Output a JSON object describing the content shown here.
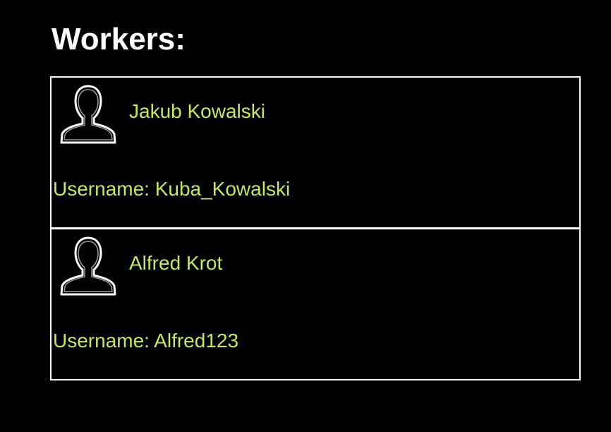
{
  "page": {
    "title": "Workers:"
  },
  "colors": {
    "background": "#000000",
    "title": "#ffffff",
    "accent_text": "#c5e860",
    "border": "#ffffff"
  },
  "workers": [
    {
      "name": "Jakub Kowalski",
      "username_line": "Username: Kuba_Kowalski",
      "icon": "user-silhouette-icon"
    },
    {
      "name": "Alfred Krot",
      "username_line": "Username: Alfred123",
      "icon": "user-silhouette-icon"
    }
  ]
}
